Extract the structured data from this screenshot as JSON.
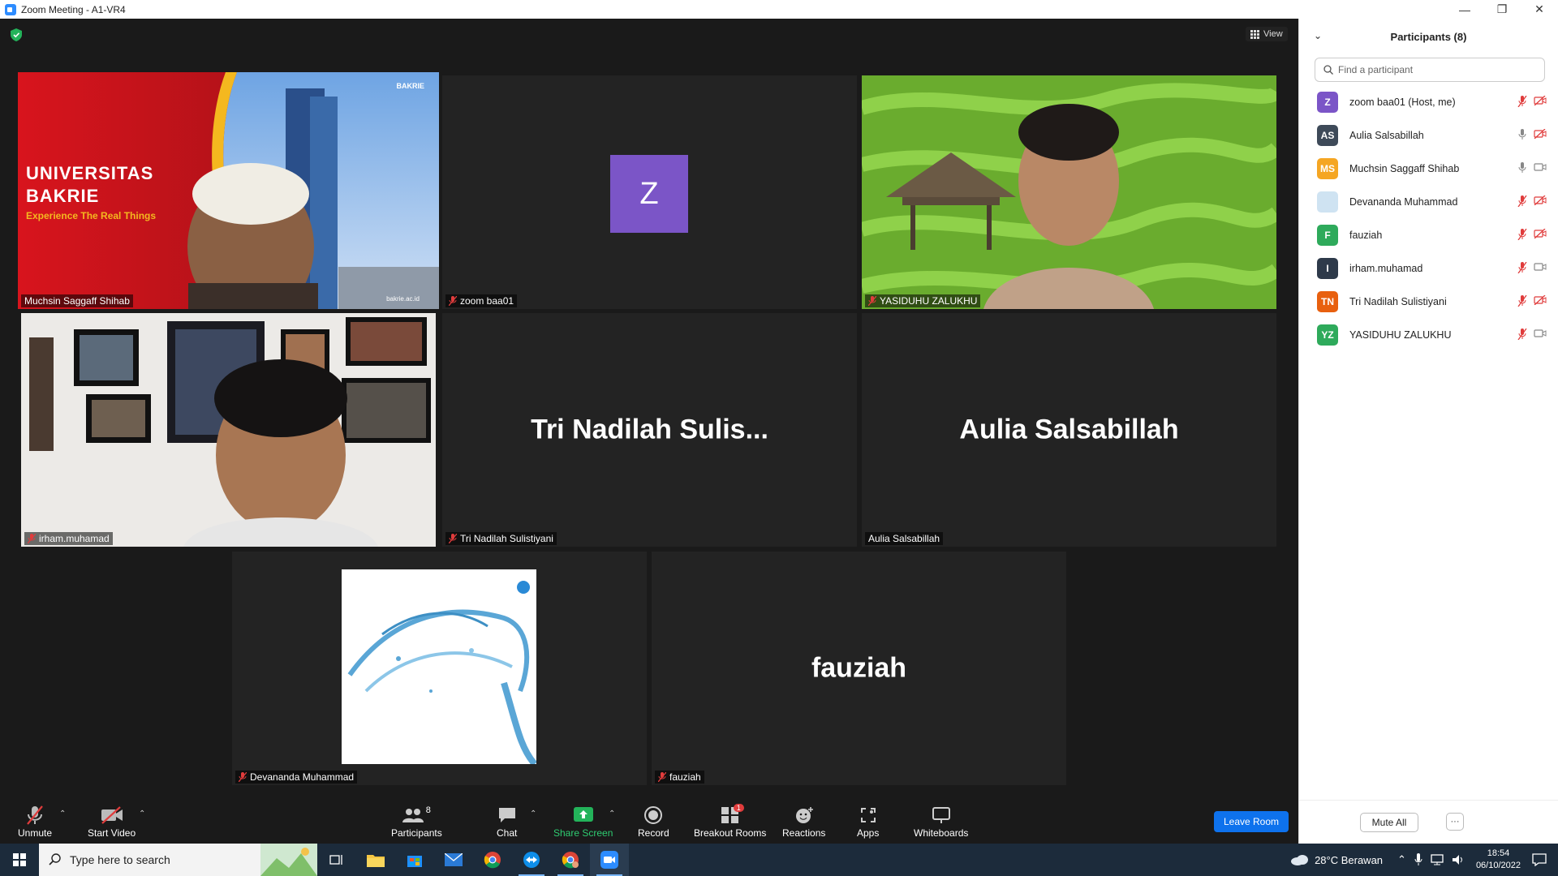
{
  "window": {
    "title": "Zoom Meeting - A1-VR4"
  },
  "stage": {
    "view_label": "View",
    "tiles": [
      {
        "name": "Muchsin Saggaff Shihab",
        "muted": false,
        "active": true,
        "overlay_line1": "UNIVERSITAS",
        "overlay_line2": "BAKRIE",
        "overlay_tagline": "Experience The Real Things",
        "overlay_badge": "BAKRIE",
        "overlay_url": "bakrie.ac.id"
      },
      {
        "name": "zoom baa01",
        "muted": true,
        "avatar_letter": "Z"
      },
      {
        "name": "YASIDUHU ZALUKHU",
        "muted": true
      },
      {
        "name": "irham.muhamad",
        "muted": true
      },
      {
        "name": "Tri Nadilah Sulistiyani",
        "muted": true,
        "display_name": "Tri  Nadilah  Sulis..."
      },
      {
        "name": "Aulia Salsabillah",
        "muted": false,
        "display_name": "Aulia Salsabillah"
      },
      {
        "name": "Devananda Muhammad",
        "muted": true
      },
      {
        "name": "fauziah",
        "muted": true,
        "display_name": "fauziah"
      }
    ]
  },
  "toolbar": {
    "unmute": "Unmute",
    "start_video": "Start Video",
    "participants": "Participants",
    "participants_count": "8",
    "chat": "Chat",
    "share_screen": "Share Screen",
    "record": "Record",
    "breakout_rooms": "Breakout Rooms",
    "breakout_badge": "1",
    "reactions": "Reactions",
    "apps": "Apps",
    "whiteboards": "Whiteboards",
    "leave_room": "Leave Room"
  },
  "panel": {
    "title": "Participants (8)",
    "search_placeholder": "Find a participant",
    "participants": [
      {
        "initials": "Z",
        "name": "zoom baa01 (Host, me)",
        "color": "#7b55c7",
        "mic": "off",
        "video": "off"
      },
      {
        "initials": "AS",
        "name": "Aulia Salsabillah",
        "color": "#3e4a59",
        "mic": "on",
        "video": "off"
      },
      {
        "initials": "MS",
        "name": "Muchsin Saggaff Shihab",
        "color": "#f5a623",
        "mic": "on",
        "video": "on"
      },
      {
        "initials": "",
        "name": "Devananda Muhammad",
        "color": "#cfe3f2",
        "mic": "off",
        "video": "off"
      },
      {
        "initials": "F",
        "name": "fauziah",
        "color": "#2eaa5b",
        "mic": "off",
        "video": "off"
      },
      {
        "initials": "I",
        "name": "irham.muhamad",
        "color": "#2e3a4a",
        "mic": "off",
        "video": "on"
      },
      {
        "initials": "TN",
        "name": "Tri Nadilah Sulistiyani",
        "color": "#e8600f",
        "mic": "off",
        "video": "off"
      },
      {
        "initials": "YZ",
        "name": "YASIDUHU ZALUKHU",
        "color": "#2eaa5b",
        "mic": "off",
        "video": "on"
      }
    ],
    "mute_all": "Mute All",
    "more": "···"
  },
  "taskbar": {
    "search_placeholder": "Type here to search",
    "weather": "28°C  Berawan",
    "time": "18:54",
    "date": "06/10/2022"
  }
}
